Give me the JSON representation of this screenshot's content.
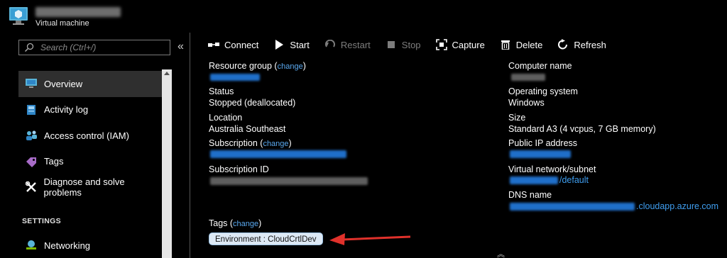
{
  "header": {
    "subtitle": "Virtual machine",
    "icon": "virtual-machine-icon"
  },
  "search": {
    "placeholder": "Search (Ctrl+/)",
    "collapse_glyph": "«"
  },
  "sidebar": {
    "items": [
      {
        "label": "Overview",
        "icon": "monitor-icon",
        "active": true
      },
      {
        "label": "Activity log",
        "icon": "activity-log-icon"
      },
      {
        "label": "Access control (IAM)",
        "icon": "users-icon"
      },
      {
        "label": "Tags",
        "icon": "tag-icon"
      },
      {
        "label": "Diagnose and solve problems",
        "icon": "wrench-icon"
      }
    ],
    "settings_header": "SETTINGS",
    "settings_items": [
      {
        "label": "Networking",
        "icon": "network-icon"
      }
    ]
  },
  "toolbar": {
    "connect": "Connect",
    "start": "Start",
    "restart": "Restart",
    "stop": "Stop",
    "capture": "Capture",
    "delete": "Delete",
    "refresh": "Refresh"
  },
  "properties": {
    "left": {
      "resource_group_label": "Resource group",
      "change": "change",
      "status_label": "Status",
      "status_value": "Stopped (deallocated)",
      "location_label": "Location",
      "location_value": "Australia Southeast",
      "subscription_label": "Subscription",
      "subscription_id_label": "Subscription ID"
    },
    "right": {
      "computer_name_label": "Computer name",
      "os_label": "Operating system",
      "os_value": "Windows",
      "size_label": "Size",
      "size_value": "Standard A3 (4 vcpus, 7 GB memory)",
      "public_ip_label": "Public IP address",
      "vnet_label": "Virtual network/subnet",
      "vnet_suffix": "/default",
      "dns_label": "DNS name",
      "dns_suffix": ".cloudapp.azure.com"
    }
  },
  "tags": {
    "label": "Tags",
    "change": "change",
    "items": [
      "Environment : CloudCrtlDev"
    ]
  },
  "colors": {
    "background": "#000000",
    "link": "#3f9ef0",
    "tag_bg": "#dde9f5",
    "annotation_arrow": "#e0312b"
  }
}
